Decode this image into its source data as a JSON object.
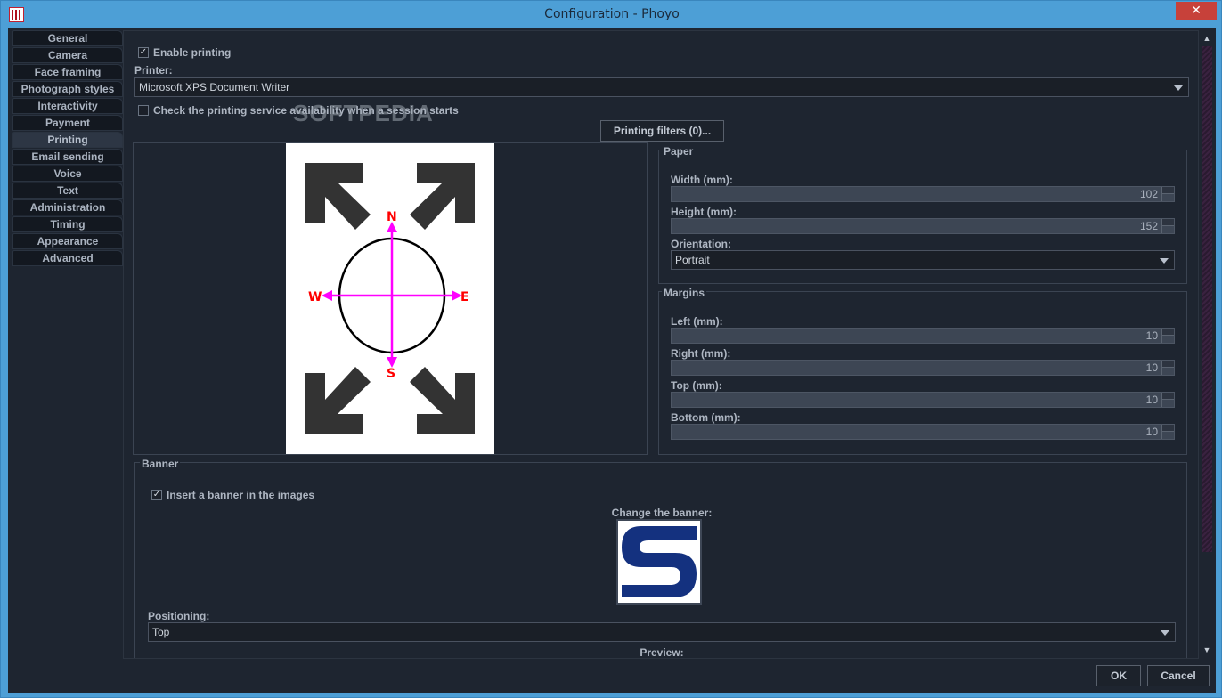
{
  "window": {
    "title": "Configuration - Phoyo",
    "close_glyph": "✕"
  },
  "sidebar": {
    "items": [
      {
        "label": "General"
      },
      {
        "label": "Camera"
      },
      {
        "label": "Face framing"
      },
      {
        "label": "Photograph styles"
      },
      {
        "label": "Interactivity"
      },
      {
        "label": "Payment"
      },
      {
        "label": "Printing"
      },
      {
        "label": "Email sending"
      },
      {
        "label": "Voice"
      },
      {
        "label": "Text"
      },
      {
        "label": "Administration"
      },
      {
        "label": "Timing"
      },
      {
        "label": "Appearance"
      },
      {
        "label": "Advanced"
      }
    ],
    "active": "Printing"
  },
  "printing": {
    "enable_label": "Enable printing",
    "enable_checked": true,
    "printer_label": "Printer:",
    "printer_value": "Microsoft XPS Document Writer",
    "check_service_label": "Check the printing service availability when a session starts",
    "check_service_checked": false,
    "filters_button": "Printing filters (0)..."
  },
  "paper": {
    "title": "Paper",
    "width_label": "Width (mm):",
    "width_value": "102",
    "height_label": "Height (mm):",
    "height_value": "152",
    "orientation_label": "Orientation:",
    "orientation_value": "Portrait"
  },
  "margins": {
    "title": "Margins",
    "left_label": "Left (mm):",
    "left_value": "10",
    "right_label": "Right (mm):",
    "right_value": "10",
    "top_label": "Top (mm):",
    "top_value": "10",
    "bottom_label": "Bottom (mm):",
    "bottom_value": "10"
  },
  "preview": {
    "compass": {
      "n": "N",
      "s": "S",
      "e": "E",
      "w": "W"
    }
  },
  "banner": {
    "title": "Banner",
    "insert_label": "Insert a banner in the images",
    "insert_checked": true,
    "change_label": "Change the banner:",
    "positioning_label": "Positioning:",
    "positioning_value": "Top",
    "preview_label": "Preview:"
  },
  "footer": {
    "ok": "OK",
    "cancel": "Cancel"
  },
  "watermark": "SOFTPEDIA",
  "colors": {
    "accent_magenta": "#ff00ff",
    "compass_red": "#ff0000",
    "banner_blue": "#1a3a8a"
  }
}
